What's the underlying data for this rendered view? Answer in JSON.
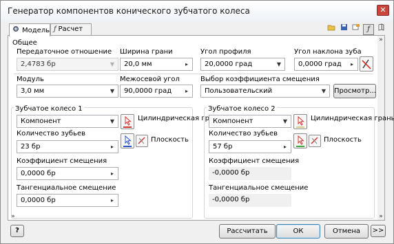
{
  "window": {
    "title": "Генератор компонентов конического зубчатого колеса",
    "close_glyph": "✕"
  },
  "tabs": [
    {
      "label": "Модель",
      "icon": "gear-model-icon",
      "active": true
    },
    {
      "label": "Расчет",
      "icon": "formula-icon",
      "active": false
    }
  ],
  "toolbar": {
    "icons": [
      "open-folder-icon",
      "save-icon",
      "settings-icon",
      "formula-toggle-icon",
      "book-icon"
    ]
  },
  "general": {
    "section_title": "Общее",
    "gear_ratio": {
      "label": "Передаточное отношение",
      "value": "2,4783 бр"
    },
    "face_width": {
      "label": "Ширина грани",
      "value": "20,0 мм"
    },
    "pressure_angle": {
      "label": "Угол профиля",
      "value": "20,0000 град"
    },
    "helix_angle": {
      "label": "Угол наклона зуба",
      "value": "0,0000 град"
    },
    "module": {
      "label": "Модуль",
      "value": "3,0 мм"
    },
    "shaft_angle": {
      "label": "Межосевой угол",
      "value": "90,0000 град"
    },
    "offset_select": {
      "label": "Выбор коэффициента смещения",
      "value": "Пользовательский"
    },
    "preview_button": "Просмотр..."
  },
  "gear1": {
    "title": "Зубчатое колесо 1",
    "type_value": "Компонент",
    "cyl_face_label": "Цилиндрическая грань",
    "plane_label": "Плоскость",
    "teeth_label": "Количество зубьев",
    "teeth_value": "23 бр",
    "offset_label": "Коэффициент смещения",
    "offset_value": "0,0000 бр",
    "tangential_label": "Тангенциальное смещение",
    "tangential_value": "0,0000 бр"
  },
  "gear2": {
    "title": "Зубчатое колесо 2",
    "type_value": "Компонент",
    "cyl_face_label": "Цилиндрическая грань",
    "plane_label": "Плоскость",
    "teeth_label": "Количество зубьев",
    "teeth_value": "57 бр",
    "offset_label": "Коэффициент смещения",
    "offset_value": "-0,0000 бр",
    "tangential_label": "Тангенциальное смещение",
    "tangential_value": "-0,0000 бр"
  },
  "footer": {
    "help_glyph": "?",
    "calculate": "Рассчитать",
    "ok": "ОК",
    "cancel": "Отмена",
    "more": ">>"
  },
  "colors": {
    "accent_red": "#d0342c",
    "accent_blue": "#2a50c8",
    "accent_green": "#3aa83a",
    "ok_border": "#3c7fb1"
  }
}
